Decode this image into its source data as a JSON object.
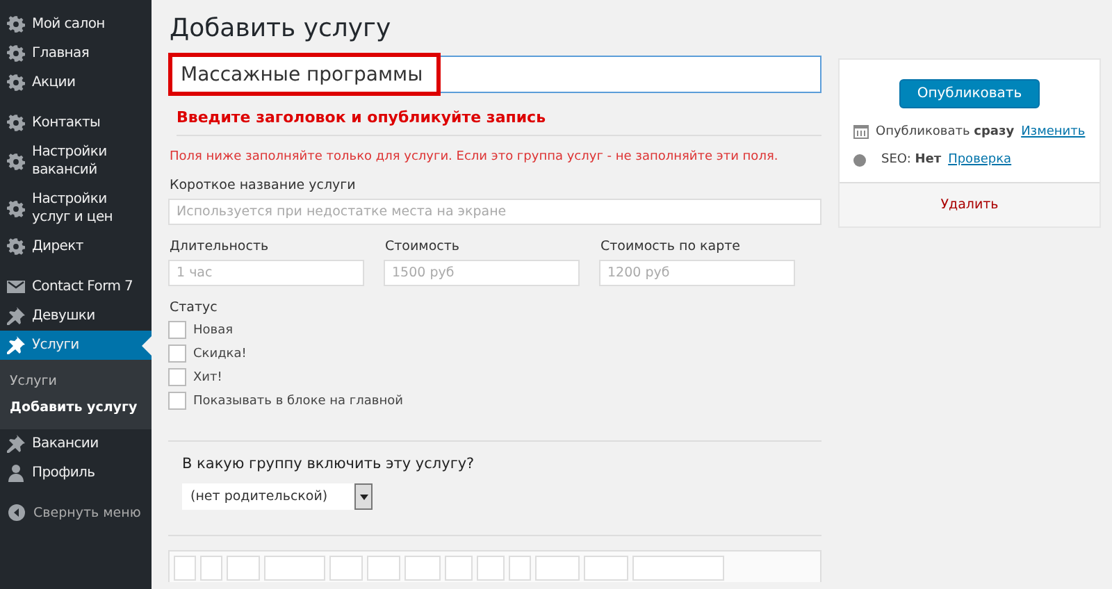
{
  "sidebar": {
    "groups": [
      [
        {
          "label": "Мой салон",
          "kind": "gear",
          "selected": false
        },
        {
          "label": "Главная",
          "kind": "gear",
          "selected": false
        },
        {
          "label": "Акции",
          "kind": "gear",
          "selected": false
        }
      ],
      [
        {
          "label": "Контакты",
          "kind": "gear",
          "selected": false
        },
        {
          "label": "Настройки вакансий",
          "kind": "gear",
          "selected": false
        },
        {
          "label": "Настройки услуг и цен",
          "kind": "gear",
          "selected": false
        },
        {
          "label": "Директ",
          "kind": "gear",
          "selected": false
        }
      ],
      [
        {
          "label": "Contact Form 7",
          "kind": "mail",
          "selected": false
        },
        {
          "label": "Девушки",
          "kind": "pin",
          "selected": false
        },
        {
          "label": "Услуги",
          "kind": "pin",
          "selected": true,
          "children": [
            {
              "label": "Услуги",
              "selected": false
            },
            {
              "label": "Добавить услугу",
              "selected": true
            }
          ]
        },
        {
          "label": "Вакансии",
          "kind": "pin",
          "selected": false
        },
        {
          "label": "Профиль",
          "kind": "user",
          "selected": false
        }
      ]
    ],
    "collapse": "Свернуть меню"
  },
  "page_title": "Добавить услугу",
  "title_field": {
    "value": "Массажные программы"
  },
  "title_hint": "Введите заголовок и опубликуйте запись",
  "notice": "Поля ниже заполняйте только для услуги. Если это группа услуг - не заполняйте эти поля.",
  "short_name": {
    "label": "Короткое название услуги",
    "placeholder": "Используется при недостатке места на экране"
  },
  "fields": [
    {
      "label": "Длительность",
      "placeholder": "1 час"
    },
    {
      "label": "Стоимость",
      "placeholder": "1500 руб"
    },
    {
      "label": "Стоимость по карте",
      "placeholder": "1200 руб"
    }
  ],
  "status": {
    "label": "Статус",
    "options": [
      {
        "label": "Новая",
        "checked": false
      },
      {
        "label": "Скидка!",
        "checked": false
      },
      {
        "label": "Хит!",
        "checked": false
      },
      {
        "label": "Показывать в блоке на главной",
        "checked": false
      }
    ]
  },
  "group": {
    "question": "В какую группу включить эту услугу?",
    "value": "(нет родительской)"
  },
  "publish": {
    "button": "Опубликовать",
    "schedule": "Опубликовать **сразу**",
    "schedule_link": "Изменить",
    "seo": "SEO: **Нет**",
    "seo_link": "Проверка",
    "delete": "Удалить"
  }
}
